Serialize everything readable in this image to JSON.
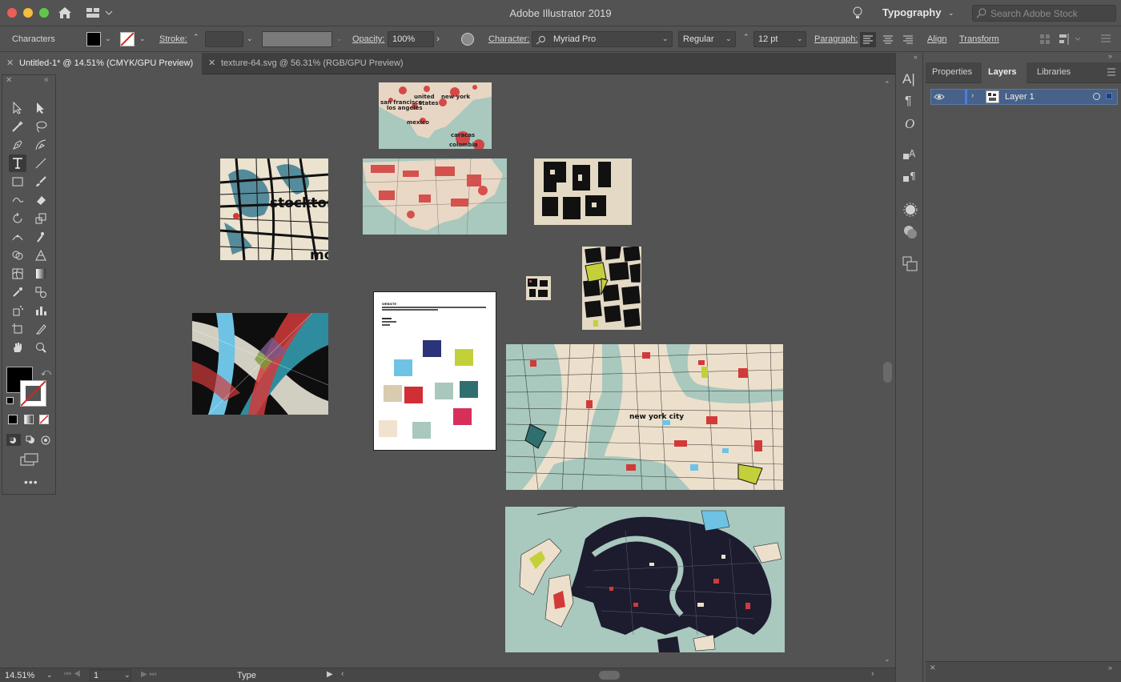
{
  "window": {
    "title": "Adobe Illustrator 2019",
    "workspace": "Typography",
    "stock_search_placeholder": "Search Adobe Stock"
  },
  "controlbar": {
    "selection_label": "Characters",
    "stroke_label": "Stroke:",
    "opacity_label": "Opacity:",
    "opacity_value": "100%",
    "character_label": "Character:",
    "font_family": "Myriad Pro",
    "font_style": "Regular",
    "font_size": "12 pt",
    "paragraph_label": "Paragraph:",
    "align_label": "Align",
    "transform_label": "Transform"
  },
  "tabs": [
    {
      "label": "Untitled-1* @ 14.51% (CMYK/GPU Preview)",
      "active": true
    },
    {
      "label": "texture-64.svg @ 56.31% (RGB/GPU Preview)",
      "active": false
    }
  ],
  "artwork": {
    "map_labels": [
      "united",
      "states",
      "new york",
      "san francisco",
      "los angeles",
      "mexico",
      "caracas",
      "colombia"
    ],
    "stockton": "stockton",
    "stockton_partial": "mo",
    "nyc": "new york city",
    "colors_doc_title": "WEBSITE",
    "swatches": [
      "#2b3479",
      "#c4d03a",
      "#6ec3e4",
      "#d8cbb0",
      "#d02f36",
      "#a8c7bd",
      "#2f6f70",
      "#d6305a",
      "#f0e2cf",
      "#a9c8be"
    ]
  },
  "panel": {
    "tabs": [
      "Properties",
      "Layers",
      "Libraries"
    ],
    "active_tab": "Layers",
    "layers": [
      {
        "name": "Layer 1"
      }
    ]
  },
  "status": {
    "zoom": "14.51%",
    "page": "1",
    "tool": "Type"
  },
  "colors": {
    "accent": "#46618a",
    "map_bg": "#a9c8be",
    "map_red": "#d23a3a",
    "map_dark": "#1c1c2e"
  }
}
